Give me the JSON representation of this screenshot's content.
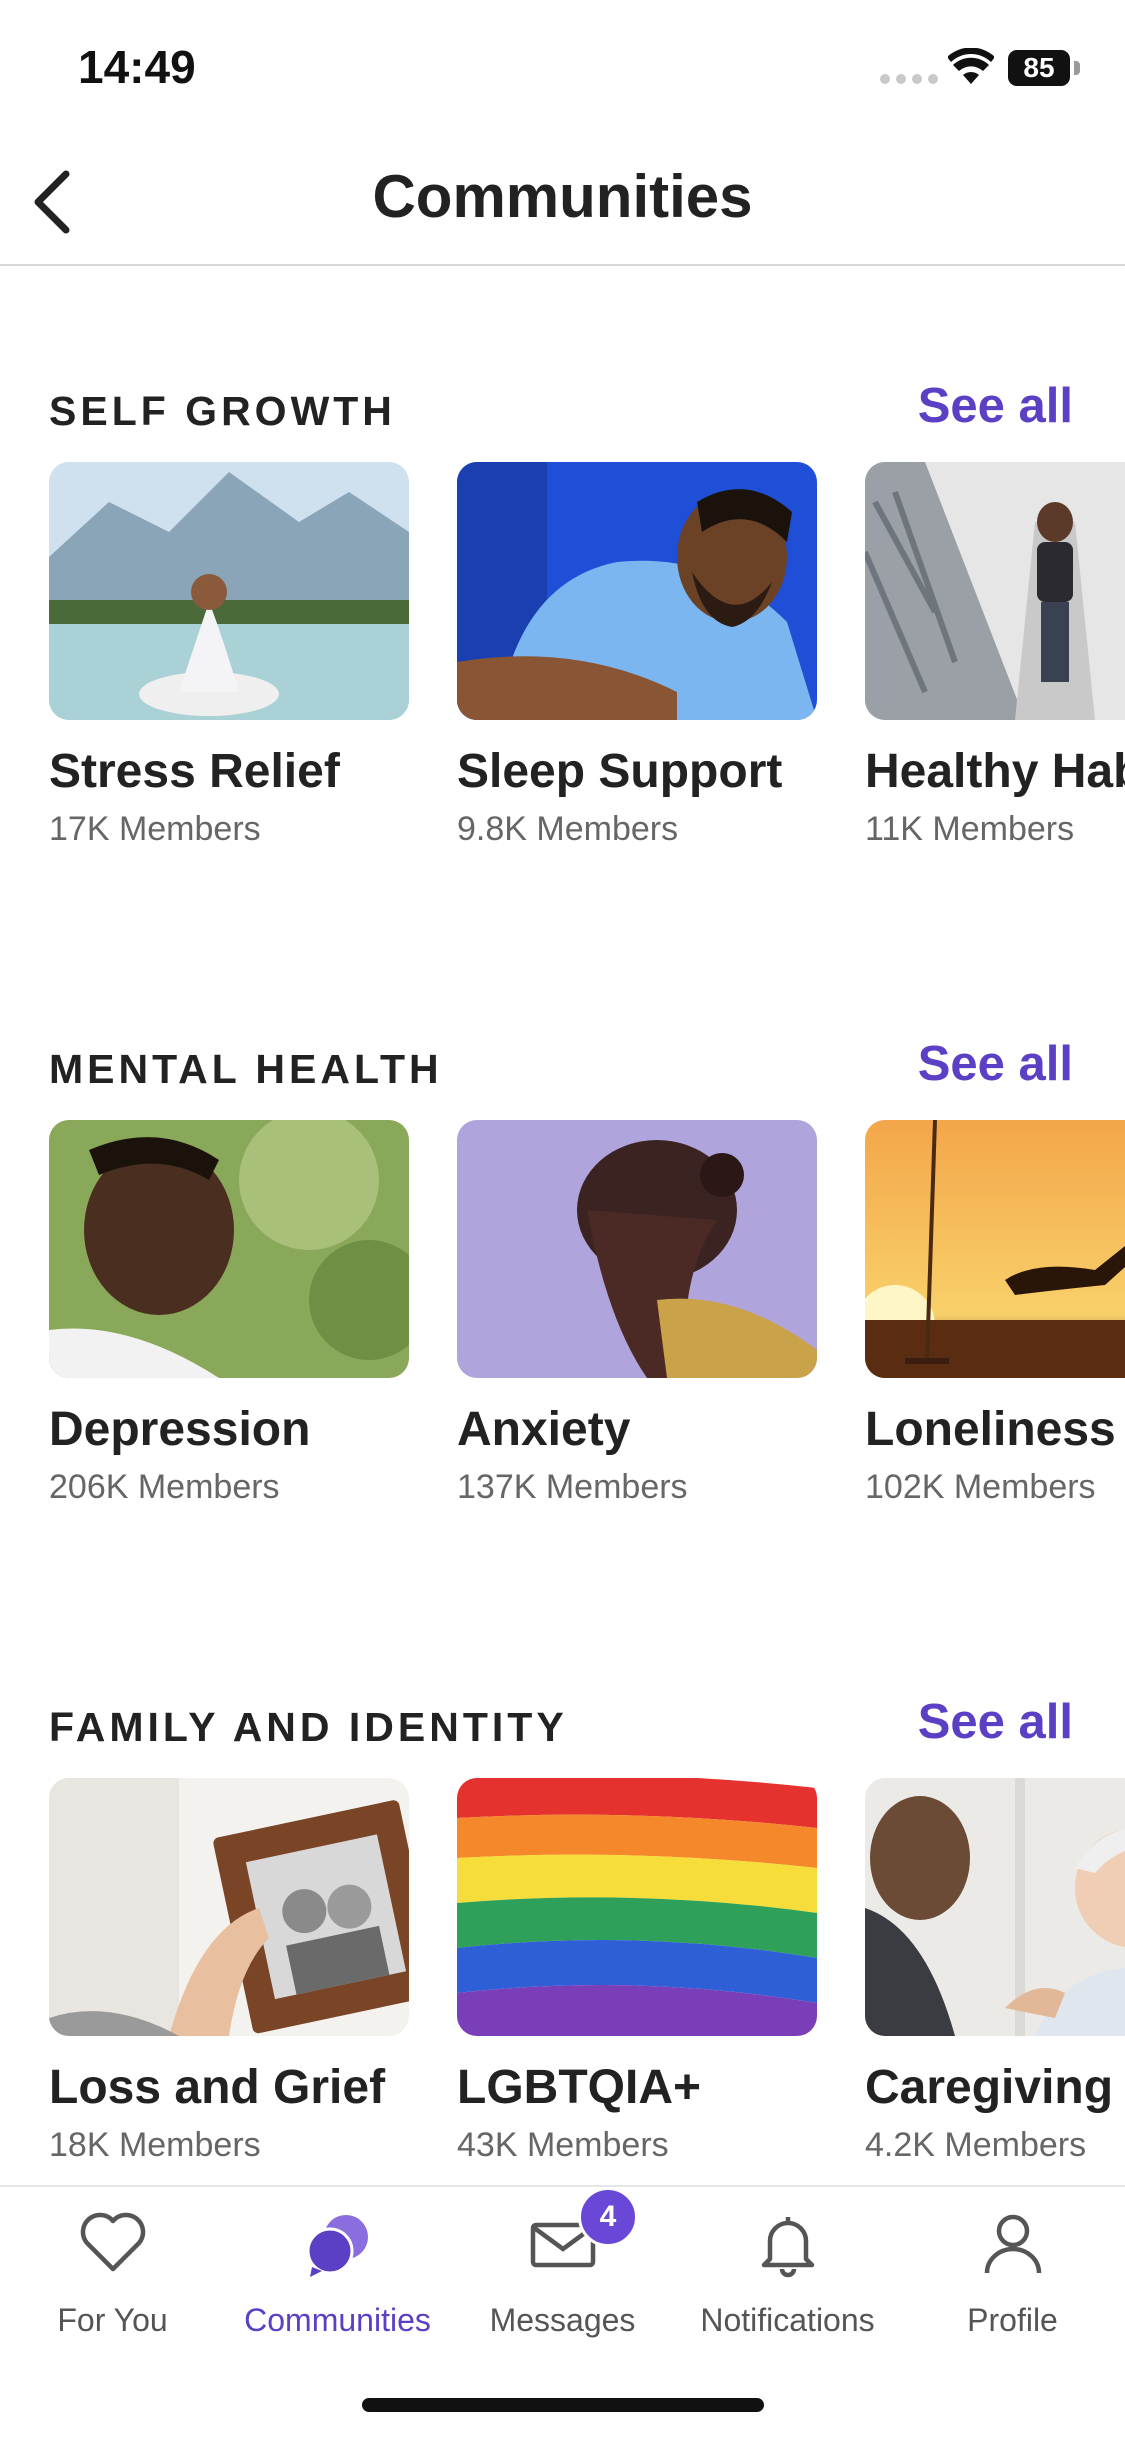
{
  "status": {
    "time": "14:49",
    "battery": "85"
  },
  "header": {
    "title": "Communities"
  },
  "sections": [
    {
      "title": "SELF GROWTH",
      "see_all": "See all",
      "cards": [
        {
          "title": "Stress Relief",
          "members": "17K Members"
        },
        {
          "title": "Sleep Support",
          "members": "9.8K Members"
        },
        {
          "title": "Healthy Hab",
          "members": "11K Members"
        }
      ]
    },
    {
      "title": "MENTAL HEALTH",
      "see_all": "See all",
      "cards": [
        {
          "title": "Depression",
          "members": "206K Members"
        },
        {
          "title": "Anxiety",
          "members": "137K Members"
        },
        {
          "title": "Loneliness",
          "members": "102K Members"
        }
      ]
    },
    {
      "title": "FAMILY AND IDENTITY",
      "see_all": "See all",
      "cards": [
        {
          "title": "Loss and Grief",
          "members": "18K Members"
        },
        {
          "title": "LGBTQIA+",
          "members": "43K Members"
        },
        {
          "title": "Caregiving",
          "members": "4.2K Members"
        }
      ]
    }
  ],
  "tabs": [
    {
      "label": "For You",
      "icon": "heart-icon"
    },
    {
      "label": "Communities",
      "icon": "communities-icon",
      "active": true
    },
    {
      "label": "Messages",
      "icon": "envelope-icon",
      "badge": "4"
    },
    {
      "label": "Notifications",
      "icon": "bell-icon"
    },
    {
      "label": "Profile",
      "icon": "person-icon"
    }
  ],
  "colors": {
    "accent": "#5b3fc4",
    "badge": "#6a48d7"
  }
}
